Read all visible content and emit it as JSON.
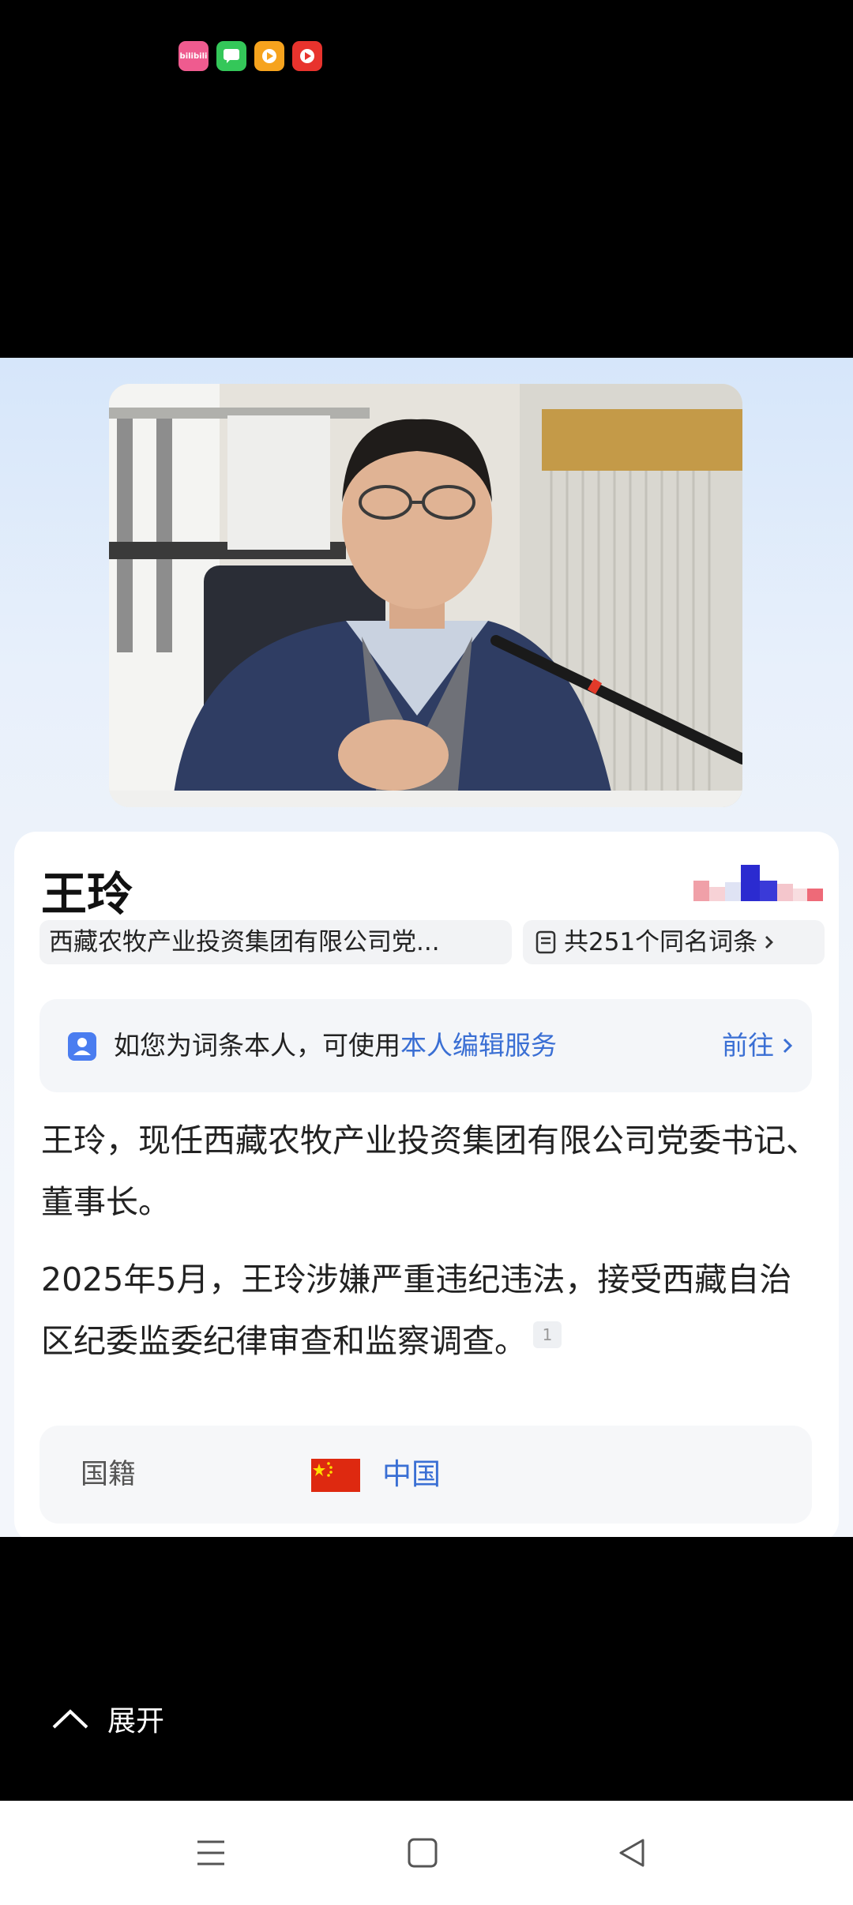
{
  "status_bar": {
    "apps": [
      {
        "icon": "bilibili-icon",
        "color": "#ef5b8f",
        "label": "bilibili"
      },
      {
        "icon": "message-icon",
        "color": "#34c759",
        "label": ""
      },
      {
        "icon": "video-app-icon",
        "color": "#f6a31d",
        "label": ""
      },
      {
        "icon": "video-player-icon",
        "color": "#e8332d",
        "label": ""
      }
    ]
  },
  "profile": {
    "photo_icon": "portrait-photo",
    "name": "王玲",
    "role_tag": "西藏农牧产业投资集团有限公司党...",
    "same_name_tag": "共251个同名词条",
    "edit_banner": {
      "prefix": "如您为词条本人，可使用",
      "link": "本人编辑服务",
      "goto": "前往"
    },
    "summary": "王玲，现任西藏农牧产业投资集团有限公司党委书记、董事长。",
    "news": "2025年5月，王玲涉嫌严重违纪违法，接受西藏自治区纪委监委纪律审查和监察调查。",
    "ref": "1",
    "nationality_label": "国籍",
    "nationality_value": "中国",
    "nationality_flag": "china-flag-icon"
  },
  "expand_label": "展开",
  "navbar": {
    "buttons": [
      "menu-icon",
      "home-icon",
      "back-icon"
    ]
  },
  "colors": {
    "accent": "#3a6fd4",
    "flag_red": "#de2910",
    "flag_star": "#ffde00"
  }
}
